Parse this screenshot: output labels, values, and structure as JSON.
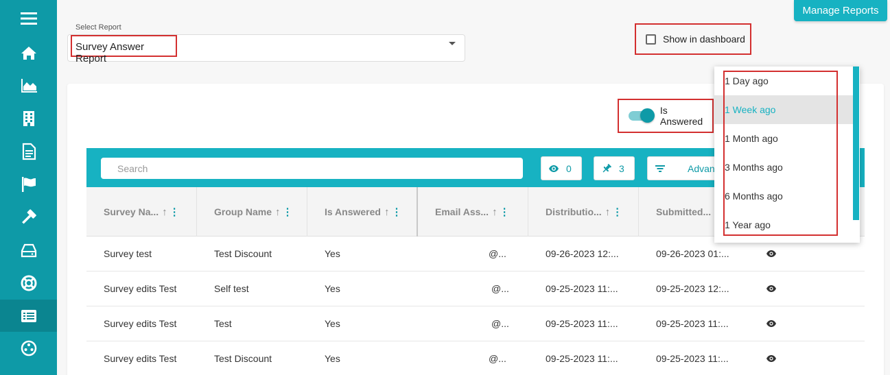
{
  "header": {
    "manage_reports": "Manage Reports",
    "select_label": "Select Report",
    "select_value": "Survey Answer Report",
    "show_in_dashboard": "Show in dashboard"
  },
  "filters": {
    "is_answered": "Is Answered"
  },
  "toolbar": {
    "search_placeholder": "Search",
    "visible_count": "0",
    "pinned_count": "3",
    "advanced": "Advance"
  },
  "columns": [
    "Survey Na...",
    "Group Name",
    "Is Answered",
    "Email Ass...",
    "Distributio...",
    "Submitted..."
  ],
  "rows": [
    {
      "survey": "Survey test",
      "group": "Test Discount",
      "answered": "Yes",
      "email": "@...",
      "distribution": "09-26-2023 12:...",
      "submitted": "09-26-2023 01:..."
    },
    {
      "survey": "Survey edits Test",
      "group": "Self test",
      "answered": "Yes",
      "email": "@...",
      "distribution": "09-25-2023 11:...",
      "submitted": "09-25-2023 12:..."
    },
    {
      "survey": "Survey edits Test",
      "group": "Test",
      "answered": "Yes",
      "email": "@...",
      "distribution": "09-25-2023 11:...",
      "submitted": "09-25-2023 11:..."
    },
    {
      "survey": "Survey edits Test",
      "group": "Test Discount",
      "answered": "Yes",
      "email": "@...",
      "distribution": "09-25-2023 11:...",
      "submitted": "09-25-2023 11:..."
    }
  ],
  "dropdown": {
    "options": [
      "1 Day ago",
      "1 Week ago",
      "1 Month ago",
      "3 Months ago",
      "6 Months ago",
      "1 Year ago"
    ],
    "selected": "1 Week ago"
  },
  "sidebar": {
    "icons": [
      "menu-icon",
      "home-icon",
      "chart-icon",
      "building-icon",
      "document-icon",
      "flag-icon",
      "gavel-icon",
      "inbox-icon",
      "lifebuoy-icon",
      "report-list-icon",
      "network-icon"
    ],
    "active": "report-list-icon"
  },
  "colors": {
    "sidebar": "#0e9aa7",
    "accent": "#17b2c2",
    "highlight": "#d32f2f"
  }
}
